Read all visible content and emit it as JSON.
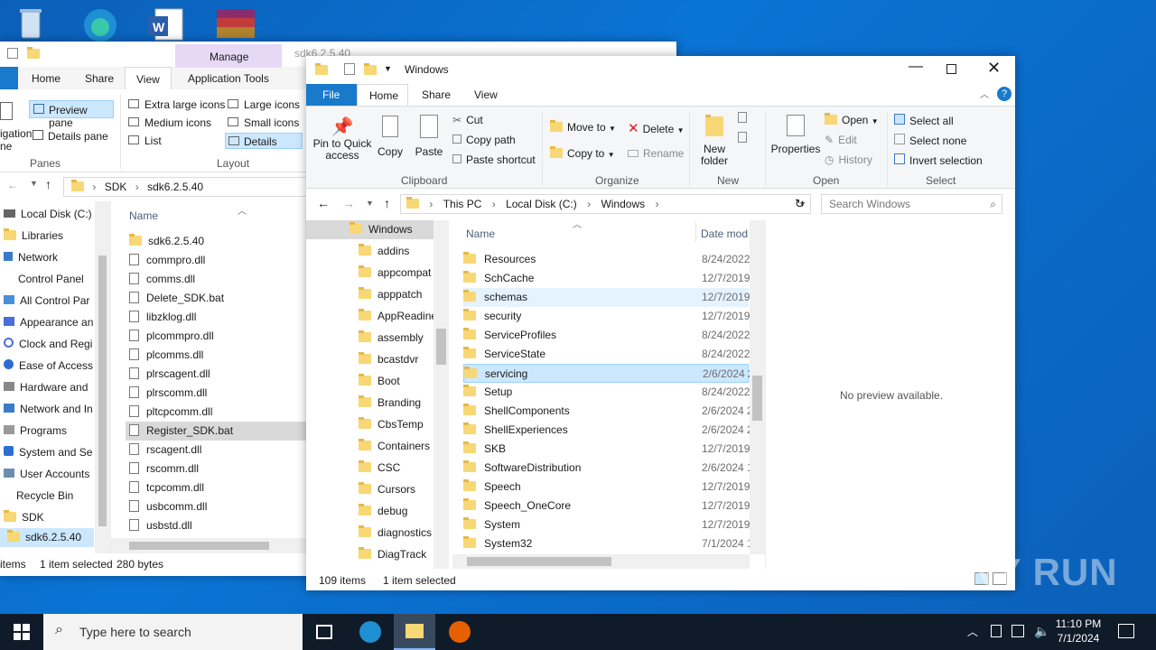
{
  "back_window": {
    "title": "sdk6.2.5.40",
    "tabs": [
      "Home",
      "Share",
      "View"
    ],
    "context_tab": "Manage",
    "context_sub": "Application Tools",
    "panes_items": [
      "Preview pane",
      "Details pane"
    ],
    "nav_label_a": "igation",
    "nav_label_b": "ne",
    "panes_label": "Panes",
    "layout_items": [
      "Extra large icons",
      "Large icons",
      "Medium icons",
      "Small icons",
      "List",
      "Details"
    ],
    "layout_label": "Layout",
    "breadcrumb": [
      "SDK",
      "sdk6.2.5.40"
    ],
    "nav_items": [
      "Local Disk (C:)",
      "Libraries",
      "Network",
      "Control Panel",
      "All Control Par",
      "Appearance an",
      "Clock and Regi",
      "Ease of Access",
      "Hardware and",
      "Network and In",
      "Programs",
      "System and Se",
      "User Accounts",
      "Recycle Bin",
      "SDK",
      "sdk6.2.5.40"
    ],
    "col_name": "Name",
    "files": [
      "sdk6.2.5.40",
      "commpro.dll",
      "comms.dll",
      "Delete_SDK.bat",
      "libzklog.dll",
      "plcommpro.dll",
      "plcomms.dll",
      "plrscagent.dll",
      "plrscomm.dll",
      "pltcpcomm.dll",
      "Register_SDK.bat",
      "rscagent.dll",
      "rscomm.dll",
      "tcpcomm.dll",
      "usbcomm.dll",
      "usbstd.dll"
    ],
    "status_items": "items",
    "status_selected": "1 item selected",
    "status_size": "280 bytes"
  },
  "front_window": {
    "title": "Windows",
    "tabs": [
      "File",
      "Home",
      "Share",
      "View"
    ],
    "clipboard": {
      "pin": "Pin to Quick access",
      "copy": "Copy",
      "paste": "Paste",
      "cut": "Cut",
      "copy_path": "Copy path",
      "paste_shortcut": "Paste shortcut",
      "label": "Clipboard"
    },
    "organize": {
      "move_to": "Move to",
      "copy_to": "Copy to",
      "delete": "Delete",
      "rename": "Rename",
      "label": "Organize"
    },
    "new": {
      "new_folder": "New folder",
      "label": "New"
    },
    "open": {
      "properties": "Properties",
      "open": "Open",
      "edit": "Edit",
      "history": "History",
      "label": "Open"
    },
    "select": {
      "all": "Select all",
      "none": "Select none",
      "invert": "Invert selection",
      "label": "Select"
    },
    "breadcrumb": [
      "This PC",
      "Local Disk (C:)",
      "Windows"
    ],
    "search_placeholder": "Search Windows",
    "tree": [
      "Windows",
      "addins",
      "appcompat",
      "apppatch",
      "AppReadine",
      "assembly",
      "bcastdvr",
      "Boot",
      "Branding",
      "CbsTemp",
      "Containers",
      "CSC",
      "Cursors",
      "debug",
      "diagnostics",
      "DiagTrack"
    ],
    "col_name": "Name",
    "col_date": "Date mod",
    "rows": [
      {
        "name": "Resources",
        "date": "8/24/2022"
      },
      {
        "name": "SchCache",
        "date": "12/7/2019"
      },
      {
        "name": "schemas",
        "date": "12/7/2019"
      },
      {
        "name": "security",
        "date": "12/7/2019"
      },
      {
        "name": "ServiceProfiles",
        "date": "8/24/2022"
      },
      {
        "name": "ServiceState",
        "date": "8/24/2022"
      },
      {
        "name": "servicing",
        "date": "2/6/2024 2"
      },
      {
        "name": "Setup",
        "date": "8/24/2022"
      },
      {
        "name": "ShellComponents",
        "date": "2/6/2024 2"
      },
      {
        "name": "ShellExperiences",
        "date": "2/6/2024 2"
      },
      {
        "name": "SKB",
        "date": "12/7/2019"
      },
      {
        "name": "SoftwareDistribution",
        "date": "2/6/2024 1"
      },
      {
        "name": "Speech",
        "date": "12/7/2019"
      },
      {
        "name": "Speech_OneCore",
        "date": "12/7/2019"
      },
      {
        "name": "System",
        "date": "12/7/2019"
      },
      {
        "name": "System32",
        "date": "7/1/2024 1"
      }
    ],
    "preview_text": "No preview available.",
    "status_count": "109 items",
    "status_selected": "1 item selected"
  },
  "taskbar": {
    "search_placeholder": "Type here to search",
    "time": "11:10 PM",
    "date": "7/1/2024"
  },
  "watermark": "ANY RUN"
}
